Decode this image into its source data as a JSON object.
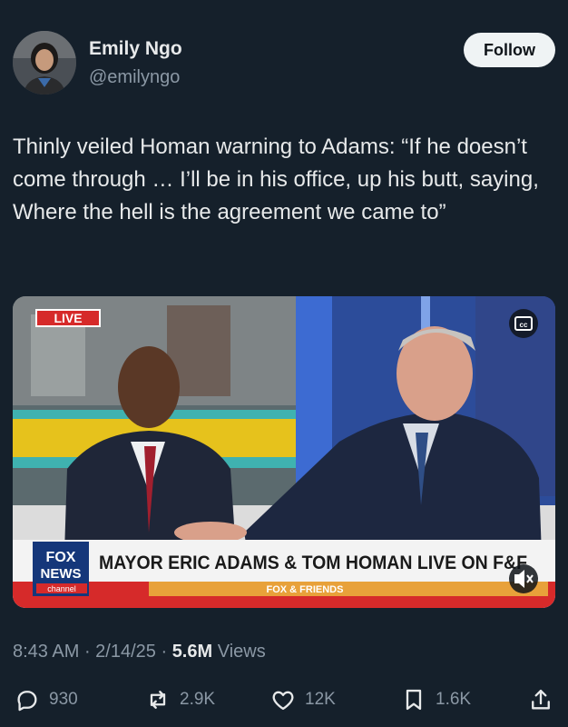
{
  "author": {
    "name": "Emily Ngo",
    "handle": "@emilyngo"
  },
  "follow_label": "Follow",
  "tweet_text": "Thinly veiled Homan warning to Adams: “If he doesn’t come through … I’ll be in his office, up his butt, saying, Where the hell is the agreement we came to”",
  "media": {
    "live_badge": "LIVE",
    "cc_icon": "closed-captions-icon",
    "logo_line1": "FOX",
    "logo_line2": "NEWS",
    "logo_line3": "channel",
    "chyron": "MAYOR ERIC ADAMS & TOM HOMAN LIVE ON F&F",
    "show_name": "FOX & FRIENDS",
    "mute_icon": "volume-muted-icon"
  },
  "meta": {
    "time": "8:43 AM",
    "date": "2/14/25",
    "views_count": "5.6M",
    "views_label": "Views"
  },
  "actions": {
    "replies": "930",
    "reposts": "2.9K",
    "likes": "12K",
    "bookmarks": "1.6K"
  },
  "colors": {
    "background": "#15202b",
    "text": "#e7e9ea",
    "muted": "#8b98a5",
    "follow_bg": "#eff3f4"
  }
}
